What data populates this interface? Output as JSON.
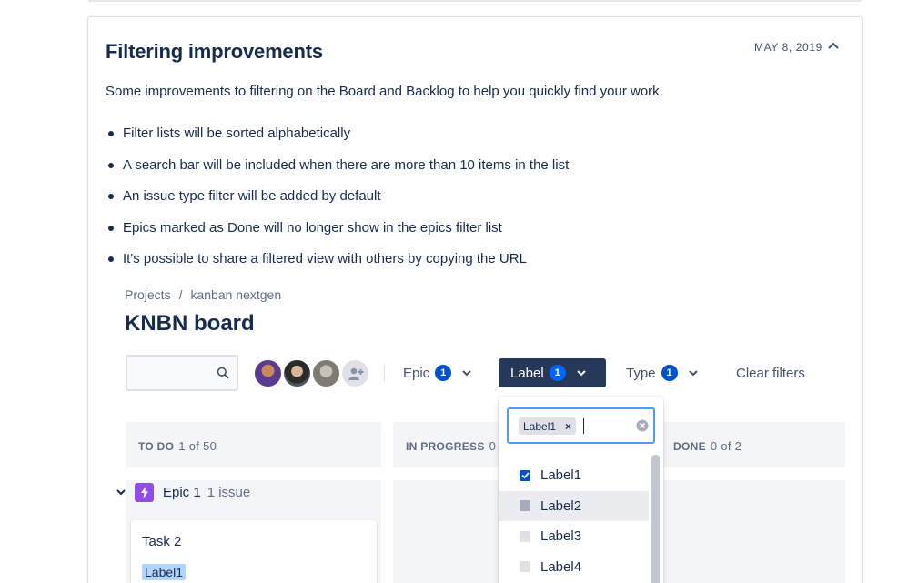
{
  "release_note": {
    "title": "Filtering improvements",
    "date": "MAY 8, 2019",
    "intro": "Some improvements to filtering on the Board and Backlog to help you quickly find your work.",
    "bullets": [
      "Filter lists will be sorted alphabetically",
      "A search bar will be included when there are more than 10 items in the list",
      "An issue type filter will be added by default",
      "Epics marked as Done will no longer show in the epics filter list",
      "It's possible to share a filtered view with others by copying the URL"
    ]
  },
  "board": {
    "breadcrumb": {
      "projects": "Projects",
      "separator": "/",
      "project": "kanban nextgen"
    },
    "title": "KNBN board",
    "filters": {
      "epic": {
        "label": "Epic",
        "count": "1"
      },
      "label": {
        "label": "Label",
        "count": "1"
      },
      "type": {
        "label": "Type",
        "count": "1"
      },
      "clear": "Clear filters"
    },
    "columns": [
      {
        "name": "TO DO",
        "count": "1 of 50"
      },
      {
        "name": "IN PROGRESS",
        "count": "0"
      },
      {
        "name": "DONE",
        "count": "0 of 2"
      }
    ],
    "epic_row": {
      "name": "Epic 1",
      "count": "1 issue"
    },
    "task": {
      "title": "Task 2",
      "label": "Label1"
    }
  },
  "label_dropdown": {
    "chip": "Label1",
    "chip_remove": "×",
    "options": [
      {
        "label": "Label1",
        "checked": true
      },
      {
        "label": "Label2",
        "checked": false
      },
      {
        "label": "Label3",
        "checked": false
      },
      {
        "label": "Label4",
        "checked": false
      }
    ]
  },
  "colors": {
    "primary_blue": "#0052cc",
    "active_filter_bg": "#253858",
    "epic_purple": "#904ee2",
    "label_highlight": "#b3d4ff",
    "focus_border": "#4c9aff"
  }
}
